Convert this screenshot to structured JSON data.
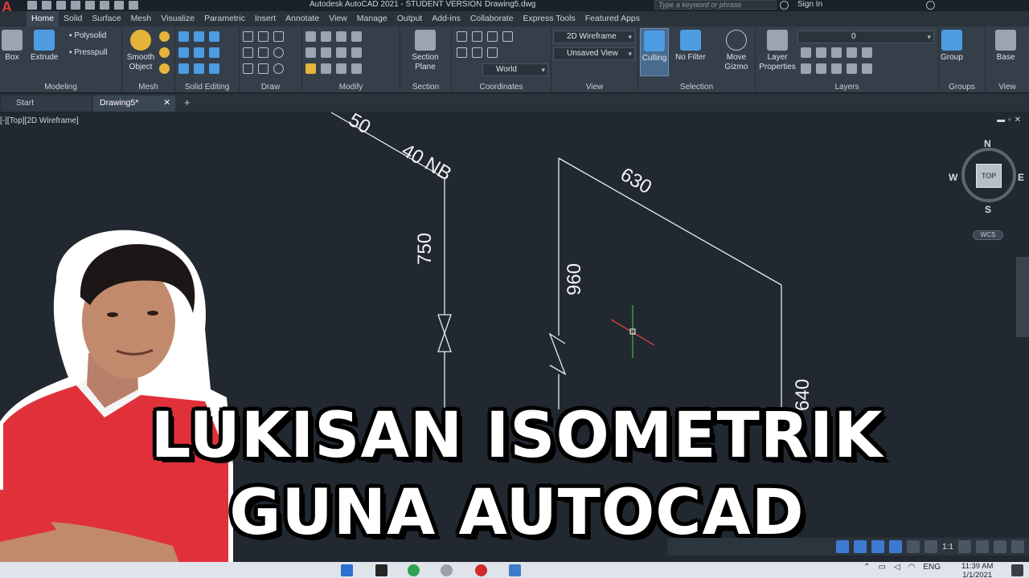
{
  "app": {
    "title": "Autodesk AutoCAD 2021 - STUDENT VERSION",
    "document": "Drawing5.dwg",
    "search_placeholder": "Type a keyword or phrase",
    "sign_in": "Sign In"
  },
  "ribbon_tabs": [
    "Home",
    "Solid",
    "Surface",
    "Mesh",
    "Visualize",
    "Parametric",
    "Insert",
    "Annotate",
    "View",
    "Manage",
    "Output",
    "Add-ins",
    "Collaborate",
    "Express Tools",
    "Featured Apps"
  ],
  "ribbon": {
    "box": "Box",
    "extrude": "Extrude",
    "polysolid": "Polysolid",
    "presspull": "Presspull",
    "smooth_object": "Smooth Object",
    "section_plane": "Section Plane",
    "visual_style": "2D Wireframe",
    "view_saved": "Unsaved View",
    "ucs": "World",
    "culling": "Culling",
    "no_filter": "No Filter",
    "move_gizmo": "Move Gizmo",
    "layer_properties": "Layer Properties",
    "layer_value": "0",
    "group": "Group",
    "base": "Base",
    "panels": {
      "modeling": "Modeling",
      "mesh": "Mesh",
      "solid_editing": "Solid Editing",
      "draw": "Draw",
      "modify": "Modify",
      "section": "Section",
      "coordinates": "Coordinates",
      "view": "View",
      "selection": "Selection",
      "layers": "Layers",
      "groups": "Groups",
      "view2": "View"
    }
  },
  "doc_tabs": {
    "start": "Start",
    "drawing": "Drawing5*"
  },
  "viewport_label": "[-][Top][2D Wireframe]",
  "viewcube": {
    "top": "TOP",
    "north": "N",
    "south": "S",
    "east": "E",
    "west": "W",
    "wcs": "WCS"
  },
  "dimensions": {
    "pipe_size": "40 NB",
    "d750": "750",
    "d630": "630",
    "d960": "960",
    "d_partial": "640",
    "d_top": "50"
  },
  "thumbnail_title": {
    "line1": "LUKISAN ISOMETRIK",
    "line2": "GUNA AUTOCAD"
  },
  "status": {
    "scale": "1:1"
  },
  "taskbar": {
    "lang": "ENG",
    "time": "11:39 AM",
    "date": "1/1/2021"
  }
}
